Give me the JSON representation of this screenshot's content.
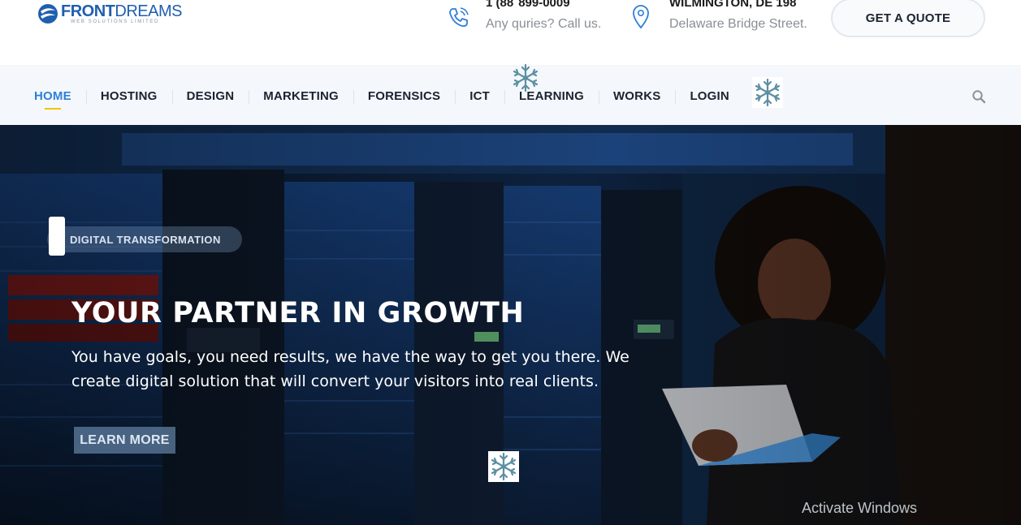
{
  "logo": {
    "name_bold": "FRONT",
    "name_light": "DREAMS",
    "tagline": "WEB SOLUTIONS LIMITED"
  },
  "contact": {
    "phone": {
      "title": "1 (88  899-0009",
      "subtitle": "Any quries? Call us."
    },
    "address": {
      "title": "WILMINGTON, DE 198",
      "subtitle": "Delaware Bridge Street."
    }
  },
  "quote_button": "GET A QUOTE",
  "nav": {
    "items": [
      {
        "label": "HOME",
        "active": true
      },
      {
        "label": "HOSTING"
      },
      {
        "label": "DESIGN"
      },
      {
        "label": "MARKETING"
      },
      {
        "label": "FORENSICS"
      },
      {
        "label": "ICT"
      },
      {
        "label": "LEARNING"
      },
      {
        "label": "WORKS"
      },
      {
        "label": "LOGIN"
      }
    ]
  },
  "hero": {
    "badge": "DIGITAL TRANSFORMATION",
    "title": "YOUR PARTNER IN GROWTH",
    "description": "You have goals, you need results, we have the way to get you there. We create digital solution that will convert your visitors into real clients.",
    "button": "LEARN MORE"
  },
  "watermark": "Activate Windows",
  "colors": {
    "brand": "#1f5fae",
    "nav_active": "#2e7fd8",
    "nav_underline": "#f4c300",
    "text_dark": "#1b2230"
  }
}
